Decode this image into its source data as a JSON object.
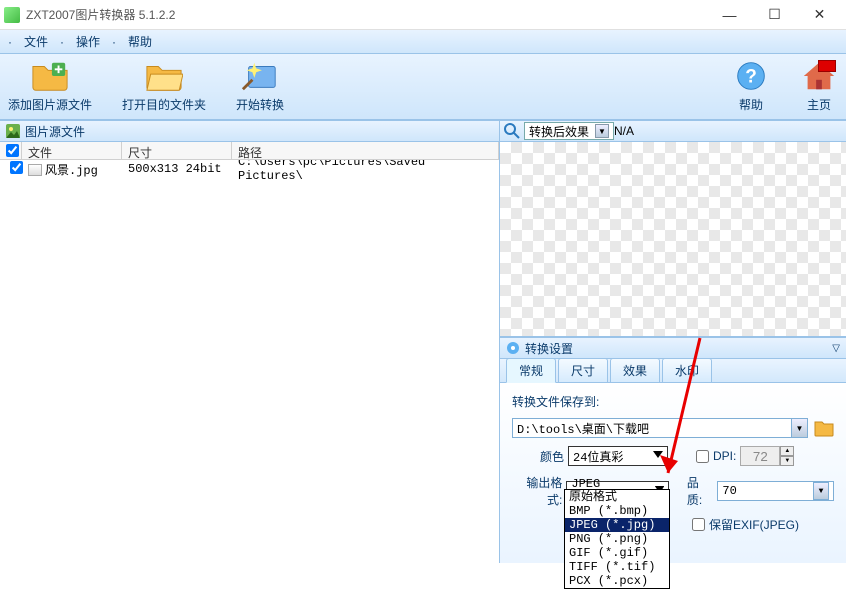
{
  "window": {
    "title": "ZXT2007图片转换器 5.1.2.2"
  },
  "menu": {
    "file": "文件",
    "ops": "操作",
    "help": "帮助"
  },
  "toolbar": {
    "add_source": "添加图片源文件",
    "open_target": "打开目的文件夹",
    "start": "开始转换",
    "help": "帮助",
    "home": "主页"
  },
  "source_panel": {
    "title": "图片源文件",
    "columns": {
      "file": "文件",
      "size": "尺寸",
      "path": "路径"
    },
    "rows": [
      {
        "checked": true,
        "name": "风景.jpg",
        "size": "500x313  24bit",
        "path": "C:\\Users\\pc\\Pictures\\Saved Pictures\\"
      }
    ]
  },
  "preview": {
    "combo_label": "转换后效果",
    "na": "N/A"
  },
  "settings": {
    "title": "转换设置",
    "tabs": {
      "general": "常规",
      "size": "尺寸",
      "effect": "效果",
      "watermark": "水印"
    },
    "save_to_label": "转换文件保存到:",
    "save_to_value": "D:\\tools\\桌面\\下载吧",
    "color_label": "颜色",
    "color_value": "24位真彩",
    "dpi_label": "DPI:",
    "dpi_value": "72",
    "format_label": "输出格式:",
    "format_value": "JPEG (*.jpg)",
    "quality_label": "品质:",
    "quality_value": "70",
    "keep_exif": "保留EXIF(JPEG)",
    "format_options": [
      "原始格式",
      "BMP (*.bmp)",
      "JPEG (*.jpg)",
      "PNG (*.png)",
      "GIF (*.gif)",
      "TIFF (*.tif)",
      "PCX (*.pcx)"
    ]
  }
}
